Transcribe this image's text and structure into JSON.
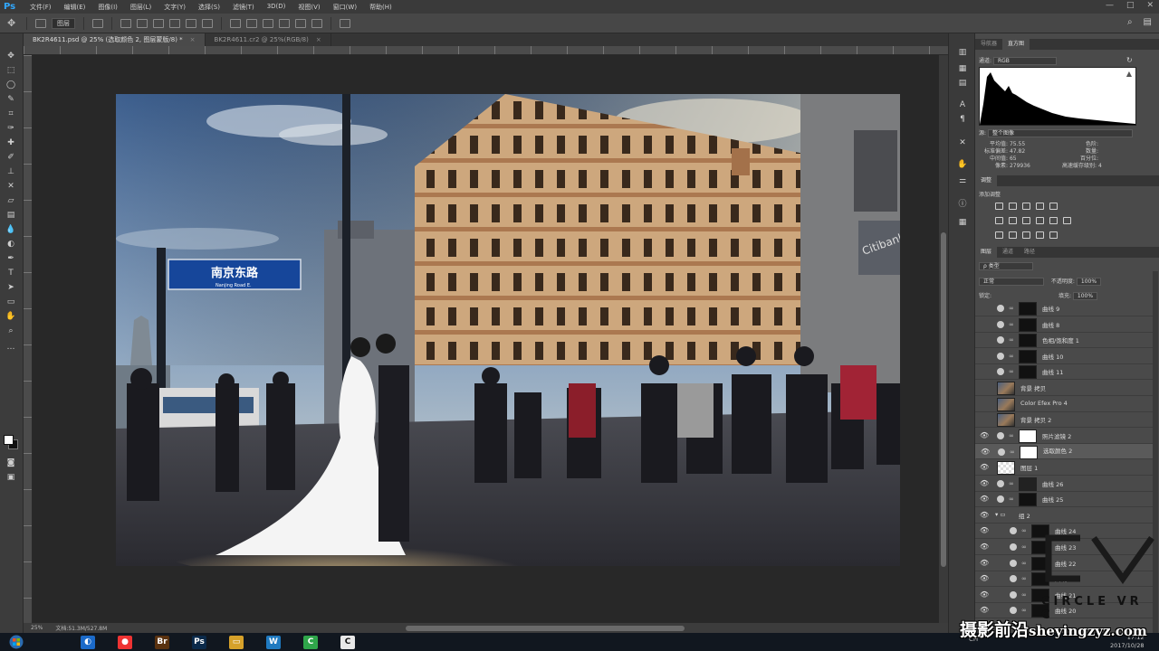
{
  "app": {
    "logo": "Ps",
    "menu": [
      "文件(F)",
      "编辑(E)",
      "图像(I)",
      "图层(L)",
      "文字(Y)",
      "选择(S)",
      "滤镜(T)",
      "3D(D)",
      "视图(V)",
      "窗口(W)",
      "帮助(H)"
    ],
    "window_controls": [
      "—",
      "□",
      "✕"
    ]
  },
  "options_bar": {
    "mode_select": "图层"
  },
  "tabs": [
    {
      "label": "BK2R4611.psd @ 25% (选取颜色 2, 图层蒙版/8) *",
      "close": "×"
    },
    {
      "label": "BK2R4611.cr2 @ 25%(RGB/8)",
      "close": "×"
    }
  ],
  "status": {
    "zoom": "25%",
    "doc_size": "文档:51.3M/527.8M"
  },
  "histogram_panel": {
    "tabs": [
      "导航器",
      "直方图"
    ],
    "channel_label": "通道:",
    "channel_value": "RGB",
    "source_label": "源:",
    "source_value": "整个图像",
    "stats": {
      "mean_label": "平均值:",
      "mean": "75.55",
      "std_label": "标准偏差:",
      "std": "47.82",
      "median_label": "中间值:",
      "median": "65",
      "pixels_label": "像素:",
      "pixels": "279936",
      "level_label": "色阶:",
      "count_label": "数量:",
      "percentile_label": "百分位:",
      "cache_label": "高速缓存级别:",
      "cache": "4"
    }
  },
  "adjust_panel": {
    "tabs": [
      "调整"
    ],
    "title": "添加调整"
  },
  "layers_panel": {
    "tabs": [
      "图层",
      "通道",
      "路径"
    ],
    "kind_select": "ρ 类型",
    "blend_mode": "正常",
    "opacity_label": "不透明度:",
    "opacity": "100%",
    "lock_label": "锁定:",
    "fill_label": "填充:",
    "fill": "100%",
    "layers": [
      {
        "name": "曲线 9",
        "eye": false,
        "adj": true,
        "thumb": "#111"
      },
      {
        "name": "曲线 8",
        "eye": false,
        "adj": true,
        "thumb": "#111"
      },
      {
        "name": "色相/饱和度 1",
        "eye": false,
        "adj": true,
        "thumb": "#111"
      },
      {
        "name": "曲线 10",
        "eye": false,
        "adj": true,
        "thumb": "#111"
      },
      {
        "name": "曲线 11",
        "eye": false,
        "adj": true,
        "thumb": "#111"
      },
      {
        "name": "背景 拷贝",
        "eye": false,
        "adj": false,
        "thumb": "photo"
      },
      {
        "name": "Color Efex Pro 4",
        "eye": false,
        "adj": false,
        "thumb": "photo"
      },
      {
        "name": "背景 拷贝 2",
        "eye": false,
        "adj": false,
        "thumb": "photo"
      },
      {
        "name": "照片滤镜 2",
        "eye": true,
        "adj": true,
        "thumb": "#fff"
      },
      {
        "name": "选取颜色 2",
        "eye": true,
        "adj": true,
        "thumb": "#fff",
        "selected": true
      },
      {
        "name": "图层 1",
        "eye": true,
        "adj": false,
        "thumb": "checker"
      },
      {
        "name": "曲线 26",
        "eye": true,
        "adj": true,
        "thumb": "#222"
      },
      {
        "name": "曲线 25",
        "eye": true,
        "adj": true,
        "thumb": "#111"
      },
      {
        "name": "组 2",
        "eye": true,
        "adj": false,
        "thumb": "none",
        "group": true
      },
      {
        "name": "曲线 24",
        "eye": true,
        "adj": true,
        "thumb": "#111",
        "indent": true
      },
      {
        "name": "曲线 23",
        "eye": true,
        "adj": true,
        "thumb": "#111",
        "indent": true
      },
      {
        "name": "曲线 22",
        "eye": true,
        "adj": true,
        "thumb": "#111",
        "indent": true
      },
      {
        "name": "曲线 20",
        "eye": true,
        "adj": true,
        "thumb": "#111",
        "indent": true
      },
      {
        "name": "曲线 21",
        "eye": true,
        "adj": true,
        "thumb": "#111",
        "indent": true
      },
      {
        "name": "曲线 20",
        "eye": true,
        "adj": true,
        "thumb": "#111",
        "indent": true
      }
    ]
  },
  "photo": {
    "street_sign": "南京东路",
    "street_sign_en": "Nanjing Road E.",
    "building_sign": "Citibank"
  },
  "watermark": {
    "logo_letters": "CV",
    "subtitle": "CIRCLE VR C",
    "cn_text": "摄影前沿",
    "domain": "sheyingzyz.com"
  },
  "taskbar": {
    "apps": [
      {
        "label": "",
        "color": "#1b6ac9",
        "glyph": "◐"
      },
      {
        "label": "",
        "color": "#e33",
        "glyph": "●"
      },
      {
        "label": "Br",
        "color": "#5a3210",
        "glyph": "Br"
      },
      {
        "label": "Ps",
        "color": "#0b2a4a",
        "glyph": "Ps"
      },
      {
        "label": "",
        "color": "#d6a12a",
        "glyph": "▭"
      },
      {
        "label": "",
        "color": "#1f7ac0",
        "glyph": "W"
      },
      {
        "label": "",
        "color": "#2fa64a",
        "glyph": "C"
      },
      {
        "label": "",
        "color": "#e8e8e8",
        "glyph": "C"
      }
    ],
    "tray": "CH",
    "time": "17:12",
    "date": "2017/10/28"
  },
  "colors": {
    "ps_blue": "#31a8ff",
    "panel_bg": "#4a4a4a",
    "canvas_bg": "#282828"
  }
}
